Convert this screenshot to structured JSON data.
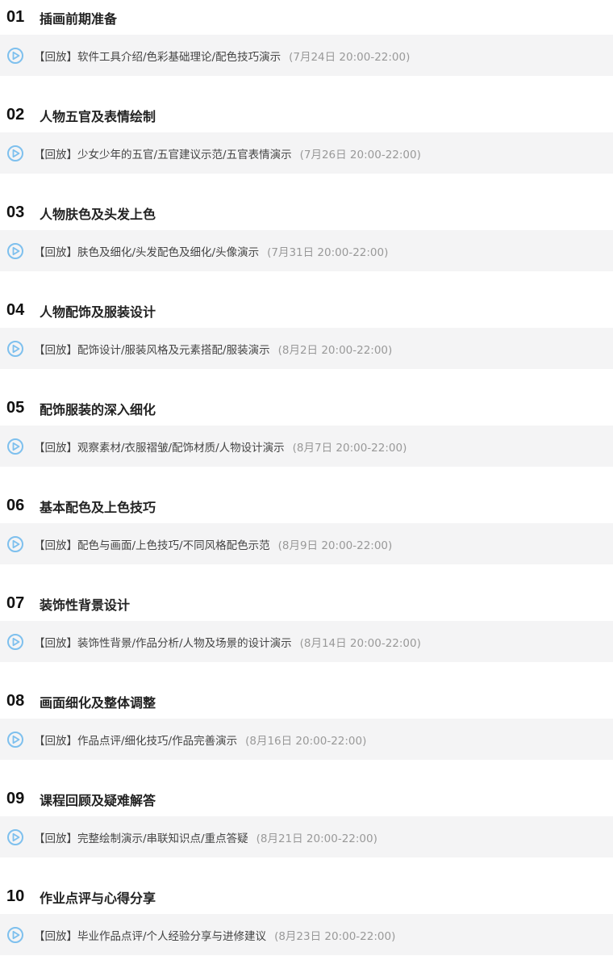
{
  "colors": {
    "background": "#ffffff",
    "lesson_row": "#f4f4f5",
    "play_icon": "#7ec0ee",
    "time_text": "#999999"
  },
  "icon": "play-circle-icon",
  "chapters": [
    {
      "num": "01",
      "title": "插画前期准备",
      "lesson": {
        "tag": "【回放】",
        "topics": "软件工具介绍/色彩基础理论/配色技巧演示",
        "time": "(7月24日 20:00-22:00)"
      }
    },
    {
      "num": "02",
      "title": "人物五官及表情绘制",
      "lesson": {
        "tag": "【回放】",
        "topics": "少女少年的五官/五官建议示范/五官表情演示",
        "time": "(7月26日 20:00-22:00)"
      }
    },
    {
      "num": "03",
      "title": "人物肤色及头发上色",
      "lesson": {
        "tag": "【回放】",
        "topics": "肤色及细化/头发配色及细化/头像演示",
        "time": "(7月31日 20:00-22:00)"
      }
    },
    {
      "num": "04",
      "title": "人物配饰及服装设计",
      "lesson": {
        "tag": "【回放】",
        "topics": "配饰设计/服装风格及元素搭配/服装演示",
        "time": "(8月2日 20:00-22:00)"
      }
    },
    {
      "num": "05",
      "title": "配饰服装的深入细化",
      "lesson": {
        "tag": "【回放】",
        "topics": "观察素材/衣服褶皱/配饰材质/人物设计演示",
        "time": "(8月7日 20:00-22:00)"
      }
    },
    {
      "num": "06",
      "title": "基本配色及上色技巧",
      "lesson": {
        "tag": "【回放】",
        "topics": "配色与画面/上色技巧/不同风格配色示范",
        "time": "(8月9日 20:00-22:00)"
      }
    },
    {
      "num": "07",
      "title": "装饰性背景设计",
      "lesson": {
        "tag": "【回放】",
        "topics": "装饰性背景/作品分析/人物及场景的设计演示",
        "time": "(8月14日 20:00-22:00)"
      }
    },
    {
      "num": "08",
      "title": "画面细化及整体调整",
      "lesson": {
        "tag": "【回放】",
        "topics": "作品点评/细化技巧/作品完善演示",
        "time": "(8月16日 20:00-22:00)"
      }
    },
    {
      "num": "09",
      "title": "课程回顾及疑难解答",
      "lesson": {
        "tag": "【回放】",
        "topics": "完整绘制演示/串联知识点/重点答疑",
        "time": "(8月21日 20:00-22:00)"
      }
    },
    {
      "num": "10",
      "title": "作业点评与心得分享",
      "lesson": {
        "tag": "【回放】",
        "topics": "毕业作品点评/个人经验分享与进修建议",
        "time": "(8月23日 20:00-22:00)"
      }
    }
  ]
}
